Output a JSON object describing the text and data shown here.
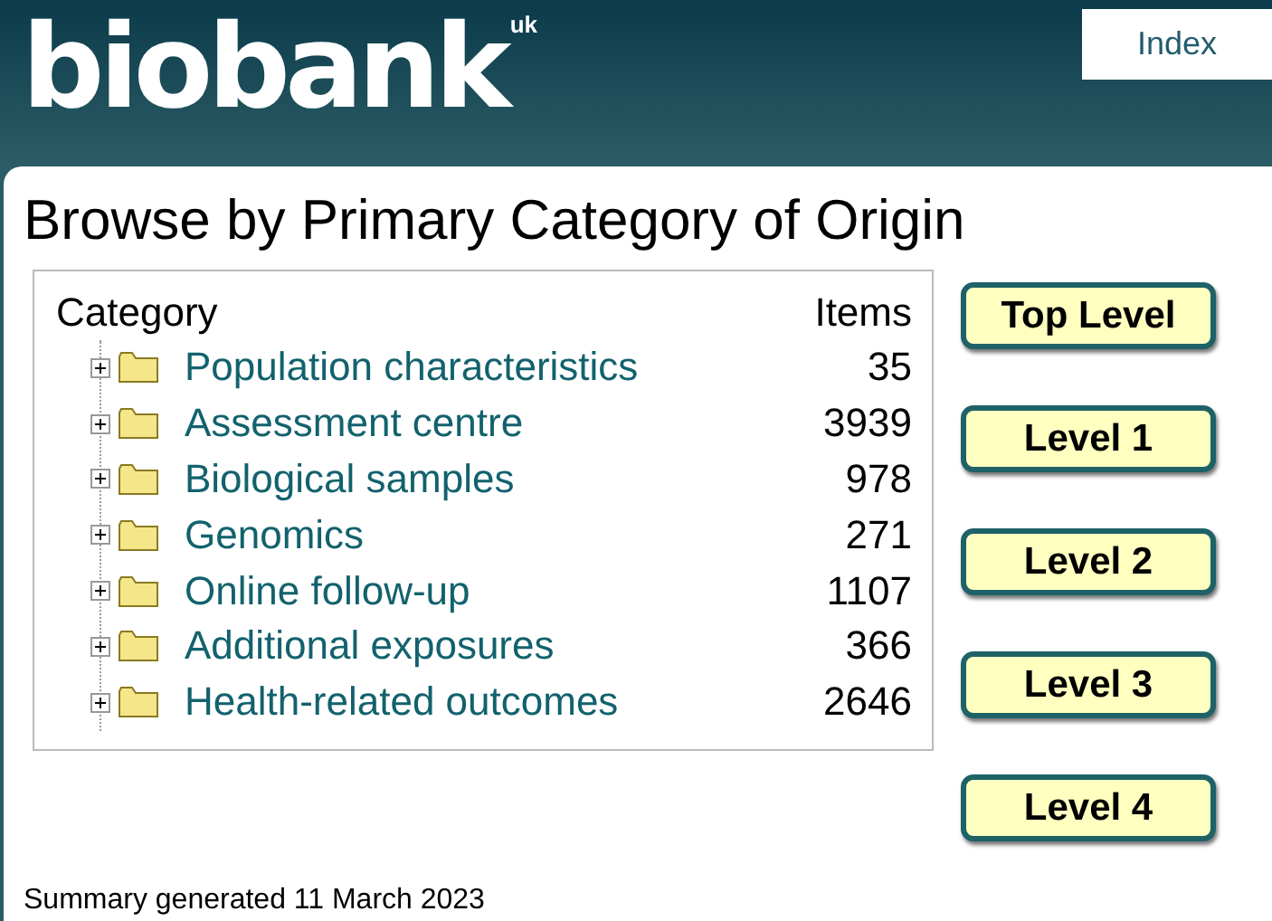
{
  "logo": {
    "name": "biobank",
    "suffix": "uk"
  },
  "nav": {
    "index_link": "Index"
  },
  "title": "Browse by Primary Category of Origin",
  "table": {
    "columns": [
      "Category",
      "Items"
    ],
    "rows": [
      {
        "label": "Population characteristics",
        "items": "35",
        "expanded": false
      },
      {
        "label": "Assessment centre",
        "items": "3939",
        "expanded": false
      },
      {
        "label": "Biological samples",
        "items": "978",
        "expanded": false
      },
      {
        "label": "Genomics",
        "items": "271",
        "expanded": false
      },
      {
        "label": "Online follow-up",
        "items": "1107",
        "expanded": false
      },
      {
        "label": "Additional exposures",
        "items": "366",
        "expanded": false
      },
      {
        "label": "Health-related outcomes",
        "items": "2646",
        "expanded": false
      }
    ]
  },
  "level_buttons": [
    "Top Level",
    "Level 1",
    "Level 2",
    "Level 3",
    "Level 4"
  ],
  "footer": "Summary generated 11 March 2023"
}
